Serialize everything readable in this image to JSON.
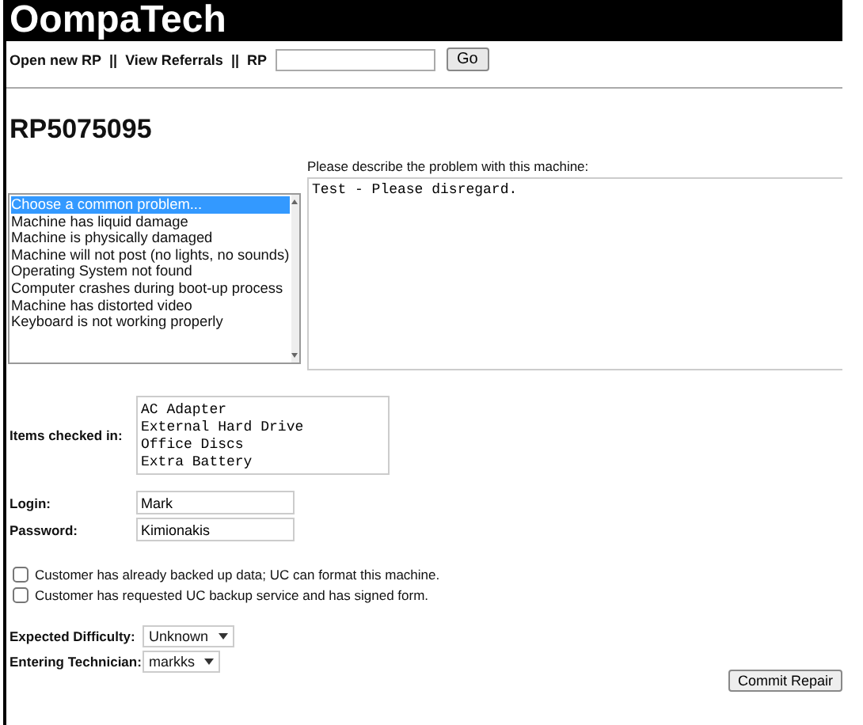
{
  "header": {
    "title": "OompaTech"
  },
  "nav": {
    "links": [
      "Open new RP",
      "View Referrals"
    ],
    "separator": "||",
    "rp_label": "RP",
    "go_button": "Go"
  },
  "heading": "RP5075095",
  "problem_list": {
    "options": [
      {
        "label": "Choose a common problem...",
        "selected": true
      },
      {
        "label": "Machine has liquid damage",
        "selected": false
      },
      {
        "label": "Machine is physically damaged",
        "selected": false
      },
      {
        "label": "Machine will not post (no lights, no sounds)",
        "selected": false
      },
      {
        "label": "Operating System not found",
        "selected": false
      },
      {
        "label": "Computer crashes during boot-up process",
        "selected": false
      },
      {
        "label": "Machine has distorted video",
        "selected": false
      },
      {
        "label": "Keyboard is not working properly",
        "selected": false
      }
    ]
  },
  "description": {
    "label": "Please describe the problem with this machine:",
    "value": "Test - Please disregard."
  },
  "items_checked_in": {
    "label": "Items checked in:",
    "value": "AC Adapter\nExternal Hard Drive\nOffice Discs\nExtra Battery"
  },
  "login": {
    "label": "Login:",
    "value": "Mark"
  },
  "password": {
    "label": "Password:",
    "value": "Kimionakis"
  },
  "checkboxes": [
    {
      "label": "Customer has already backed up data; UC can format this machine.",
      "checked": false
    },
    {
      "label": "Customer has requested UC backup service and has signed form.",
      "checked": false
    }
  ],
  "selects": [
    {
      "label": "Expected Difficulty:",
      "value": "Unknown"
    },
    {
      "label": "Entering Technician:",
      "value": "markks"
    }
  ],
  "commit_button": "Commit Repair"
}
